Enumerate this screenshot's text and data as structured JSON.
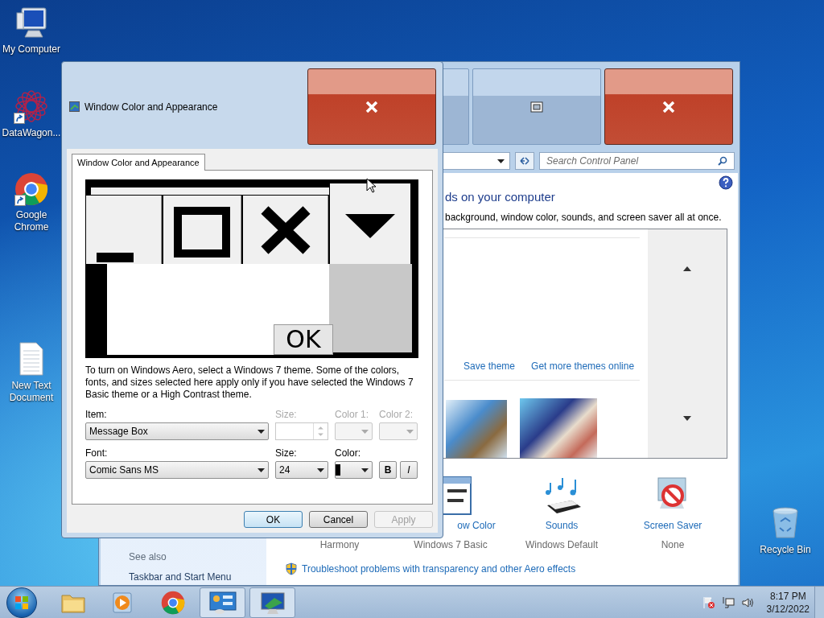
{
  "desktop_icons": [
    {
      "label": "My Computer",
      "kind": "computer",
      "shortcut": false
    },
    {
      "label": "DataWagon...",
      "kind": "network",
      "shortcut": true
    },
    {
      "label": "Google Chrome",
      "kind": "chrome",
      "shortcut": true
    },
    {
      "label": "New Text Document",
      "kind": "document",
      "shortcut": false
    },
    {
      "label": "Recycle Bin",
      "kind": "recycle",
      "shortcut": false
    }
  ],
  "control_panel": {
    "search": {
      "placeholder": "Search Control Panel"
    },
    "heading": "ds on your computer",
    "description": "background, window color, sounds, and screen saver all at once.",
    "theme_links": [
      "Save theme",
      "Get more themes online"
    ],
    "settings": [
      {
        "kind": "background",
        "subtitle": "Harmony"
      },
      {
        "kind": "color",
        "label": "ow Color",
        "subtitle": "Windows 7 Basic"
      },
      {
        "kind": "sounds",
        "label": "Sounds",
        "subtitle": "Windows Default"
      },
      {
        "kind": "screensaver",
        "label": "Screen Saver",
        "subtitle": "None"
      }
    ],
    "troubleshoot_link": "Troubleshoot problems with transparency and other Aero effects",
    "see_also": {
      "title": "See also",
      "links": [
        "Taskbar and Start Menu"
      ]
    }
  },
  "dialog": {
    "title": "Window Color and Appearance",
    "tabs": [
      {
        "label": "Window Color and Appearance",
        "selected": true
      }
    ],
    "preview_button": "OK",
    "info": "To turn on Windows Aero, select a Windows 7 theme.  Some of the colors, fonts, and sizes selected here apply only if you have selected the Windows 7 Basic theme or a High Contrast theme.",
    "fields": [
      [
        {
          "label": "Item:",
          "value": "Message Box",
          "kind": "select",
          "disabled": false
        },
        {
          "label": "Size:",
          "kind": "spin",
          "disabled": true
        },
        {
          "label": "Color 1:",
          "kind": "color",
          "disabled": true
        },
        {
          "label": "Color 2:",
          "kind": "color",
          "disabled": true
        }
      ],
      [
        {
          "label": "Font:",
          "value": "Comic Sans MS",
          "kind": "select",
          "disabled": false
        },
        {
          "label": "Size:",
          "value": "24",
          "kind": "select",
          "disabled": false
        },
        {
          "label": "Color:",
          "kind": "color",
          "disabled": false,
          "color": "#000000"
        }
      ]
    ],
    "style_buttons": [
      "B",
      "I"
    ],
    "buttons": [
      {
        "label": "OK",
        "default": true,
        "disabled": false
      },
      {
        "label": "Cancel",
        "default": false,
        "disabled": false
      },
      {
        "label": "Apply",
        "default": false,
        "disabled": true
      }
    ]
  },
  "taskbar": {
    "items": [
      {
        "kind": "folder",
        "active": false
      },
      {
        "kind": "media",
        "active": false
      },
      {
        "kind": "chrome",
        "active": false
      },
      {
        "kind": "control-panel",
        "active": true
      },
      {
        "kind": "personalization",
        "active": true
      }
    ],
    "clock": {
      "time": "8:17 PM",
      "date": "3/12/2022"
    }
  }
}
